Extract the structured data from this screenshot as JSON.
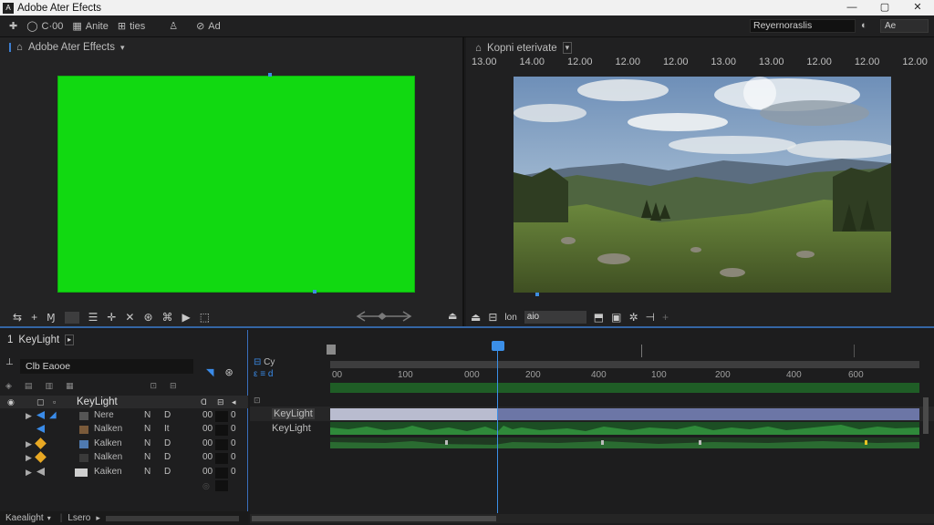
{
  "app": {
    "title": "Adobe Ater Efects",
    "window_buttons": [
      "—",
      "▢",
      "✕"
    ]
  },
  "menubar": {
    "items": [
      "C·00",
      "Anite",
      "ties",
      "Ad"
    ],
    "search_value": "Reyernoraslis",
    "right_button": "Ae"
  },
  "left_comp": {
    "title": "Adobe Ater Effects",
    "green_color": "#11d911"
  },
  "right_comp": {
    "title": "Kopni eterivate",
    "ruler": [
      "13.00",
      "14.00",
      "12.00",
      "12.00",
      "12.00",
      "13.00",
      "13.00",
      "12.00",
      "12.00",
      "12.00"
    ],
    "field_value": "aio"
  },
  "layers": {
    "tab_label": "KeyLight",
    "search_placeholder": "Clb Eaooe",
    "header_name": "KeyLight",
    "rows": [
      {
        "name": "Nere",
        "c1": "N",
        "c2": "D",
        "c3": "00",
        "c4": "0",
        "color": "#3a8be8"
      },
      {
        "name": "Nalken",
        "c1": "N",
        "c2": "It",
        "c3": "00",
        "c4": "0",
        "color": "#3a8be8"
      },
      {
        "name": "Kalken",
        "c1": "N",
        "c2": "D",
        "c3": "00",
        "c4": "0",
        "color": "#e8a823"
      },
      {
        "name": "Nalken",
        "c1": "N",
        "c2": "D",
        "c3": "00",
        "c4": "0",
        "color": "#e8a823"
      },
      {
        "name": "Kaiken",
        "c1": "N",
        "c2": "D",
        "c3": "00",
        "c4": "0",
        "color": "#aaaaaa"
      }
    ],
    "status_left": "Kaealight",
    "status_mid": "Lsero"
  },
  "timeline": {
    "ticks": [
      "00",
      "100",
      "000",
      "200",
      "400",
      "100",
      "200",
      "400",
      "600"
    ],
    "tracks": [
      "KeyLight",
      "KeyLight"
    ],
    "side_labels": [
      "Cy"
    ]
  }
}
